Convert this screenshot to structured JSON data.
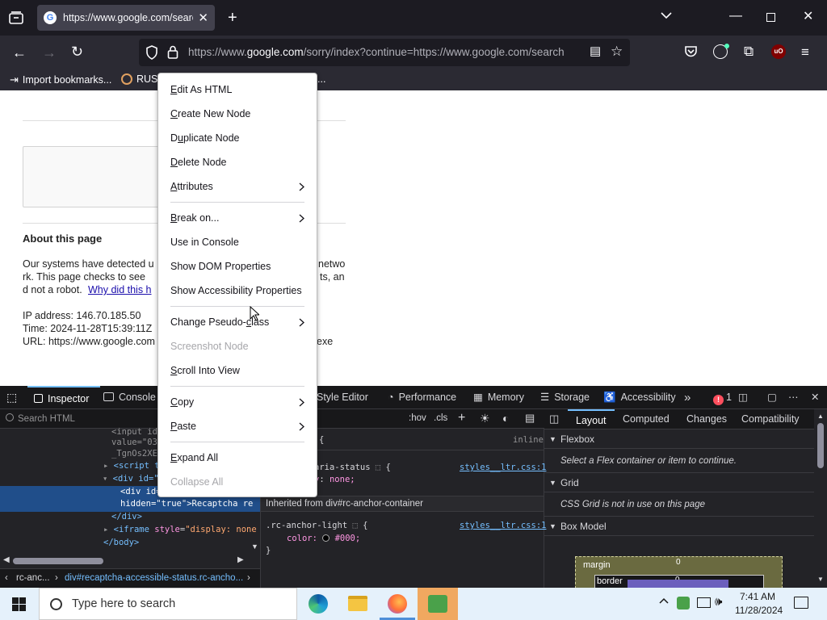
{
  "browser": {
    "tab_title": "https://www.google.com/search",
    "url_prefix": "https://www.",
    "url_domain": "google.com",
    "url_rest": "/sorry/index?continue=https://www.google.com/search",
    "bookmarks": [
      {
        "label": "Import bookmarks..."
      },
      {
        "label": "RUS"
      },
      {
        "label": "..."
      }
    ]
  },
  "page": {
    "heading": "About this page",
    "para_line1_left": "Our systems have detected u",
    "para_line1_right": "netwo",
    "para_line2_left": "rk. This page checks to see",
    "para_line2_right": "ts, an",
    "para_line3_left": "d not a robot.",
    "para_link": "Why did this h",
    "ip": "IP address: 146.70.185.50",
    "time": "Time: 2024-11-28T15:39:11Z",
    "url_left": "URL: https://www.google.com",
    "url_right": "exe"
  },
  "context_menu": {
    "items": [
      {
        "pre": "",
        "u": "E",
        "post": "dit As HTML"
      },
      {
        "pre": "",
        "u": "C",
        "post": "reate New Node"
      },
      {
        "pre": "D",
        "u": "u",
        "post": "plicate Node"
      },
      {
        "pre": "",
        "u": "D",
        "post": "elete Node"
      },
      {
        "pre": "",
        "u": "A",
        "post": "ttributes"
      },
      {
        "pre": "",
        "u": "B",
        "post": "reak on..."
      },
      {
        "pre": "Use in Console",
        "u": "",
        "post": ""
      },
      {
        "pre": "Show DOM Properties",
        "u": "",
        "post": ""
      },
      {
        "pre": "Show Accessibility Properties",
        "u": "",
        "post": ""
      },
      {
        "pre": "Change Pseudo-",
        "u": "c",
        "post": "lass"
      },
      {
        "pre": "Screenshot Node",
        "u": "",
        "post": ""
      },
      {
        "pre": "",
        "u": "S",
        "post": "croll Into View"
      },
      {
        "pre": "",
        "u": "C",
        "post": "opy"
      },
      {
        "pre": "",
        "u": "P",
        "post": "aste"
      },
      {
        "pre": "",
        "u": "E",
        "post": "xpand All"
      },
      {
        "pre": "Collapse All",
        "u": "",
        "post": ""
      }
    ]
  },
  "devtools": {
    "tabs": {
      "inspector": "Inspector",
      "console": "Console",
      "style_editor": "Style Editor",
      "performance": "Performance",
      "memory": "Memory",
      "storage": "Storage",
      "accessibility": "Accessibility",
      "error_count": "1"
    },
    "search_placeholder": "Search HTML",
    "html_lines": {
      "l1": "<input id",
      "l2": "value=\"03d",
      "l3": "_TgnOs2XEm",
      "l4_tag": "<script ty",
      "l5_tag": "<div id=\"",
      "l6_tag": "<div id=",
      "l7_attr": "hidden",
      "l7_val": "\"true\"",
      "l7_text": ">Recaptcha re",
      "l8_tag": "</div>",
      "l9_tag": "<iframe",
      "l9_attr": "style",
      "l9_val": "\"display: none",
      "l10_tag": "</body>"
    },
    "breadcrumb_1": "rc-anc...",
    "breadcrumb_2": "div#recaptcha-accessible-status.rc-ancho...",
    "rules": {
      "toolbar_hov": ":hov",
      "toolbar_cls": ".cls",
      "filter_text": "les",
      "inline": "inline",
      "brace_open": "{",
      "rule1_selector": "aria-status",
      "rule1_src": "styles__ltr.css:1",
      "rule1_decl_prop": "y",
      "rule1_decl_val": "none;",
      "inherited": "Inherited from div#rc-anchor-container",
      "rule2_selector": ".rc-anchor-light",
      "rule2_src": "styles__ltr.css:1",
      "rule2_prop": "color:",
      "rule2_val": "#000;",
      "brace_close": "}"
    },
    "layout": {
      "tabs": [
        "Layout",
        "Computed",
        "Changes",
        "Compatibility"
      ],
      "flexbox": "Flexbox",
      "flexbox_msg": "Select a Flex container or item to continue.",
      "grid": "Grid",
      "grid_msg": "CSS Grid is not in use on this page",
      "boxmodel": "Box Model",
      "margin_label": "margin",
      "margin_val": "0",
      "border_label": "border",
      "border_val": "0"
    }
  },
  "taskbar": {
    "search_placeholder": "Type here to search",
    "time": "7:41 AM",
    "date": "11/28/2024"
  }
}
